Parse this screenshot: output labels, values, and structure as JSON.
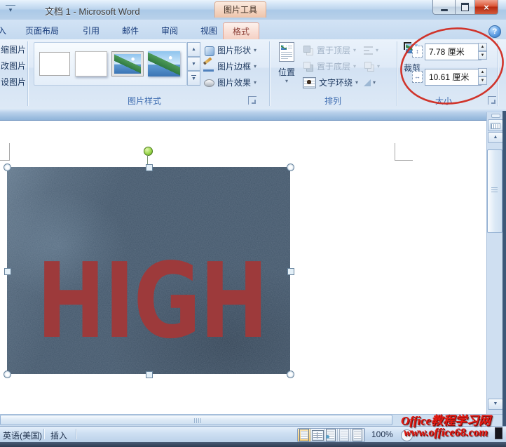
{
  "window": {
    "title": "文档 1 - Microsoft Word",
    "context_tool": "图片工具"
  },
  "tabs": {
    "partial_left": "入",
    "items": [
      "页面布局",
      "引用",
      "邮件",
      "审阅",
      "视图"
    ],
    "active": "格式"
  },
  "ribbon": {
    "adjust": {
      "items": [
        "缩图片",
        "改图片",
        "设图片"
      ]
    },
    "picture_styles": {
      "group_label": "图片样式",
      "shape_button": "图片形状",
      "border_button": "图片边框",
      "effects_button": "图片效果"
    },
    "arrange": {
      "group_label": "排列",
      "position_button": "位置",
      "bring_to_front": "置于顶层",
      "send_to_back": "置于底层",
      "text_wrapping": "文字环绕"
    },
    "size": {
      "group_label": "大小",
      "crop_button": "裁剪",
      "height_value": "7.78 厘米",
      "width_value": "10.61 厘米"
    }
  },
  "document": {
    "picture_text": "HIGH"
  },
  "status_bar": {
    "language": "英语(美国)",
    "insert_mode": "插入",
    "zoom_level": "100%"
  },
  "watermark": {
    "line1": "Office教程学习网",
    "line2": "www.office68.com"
  },
  "icons": {
    "qat_more": "▾",
    "help": "?",
    "close": "×",
    "dropdown": "▾",
    "gallery_up": "▲",
    "gallery_down": "▼",
    "gallery_more": "▼",
    "spin_up": "▲",
    "spin_down": "▼",
    "scroll_up": "▲",
    "scroll_down": "▼",
    "scroll_right": "▶",
    "height_arrow": "↕",
    "width_arrow": "↔",
    "zoom_out": "−"
  },
  "colors": {
    "annotation_red": "#d02a20",
    "picture_bg": "#42566a",
    "picture_text_red": "#9d3a3b",
    "active_tab_text": "#8a3c34"
  }
}
